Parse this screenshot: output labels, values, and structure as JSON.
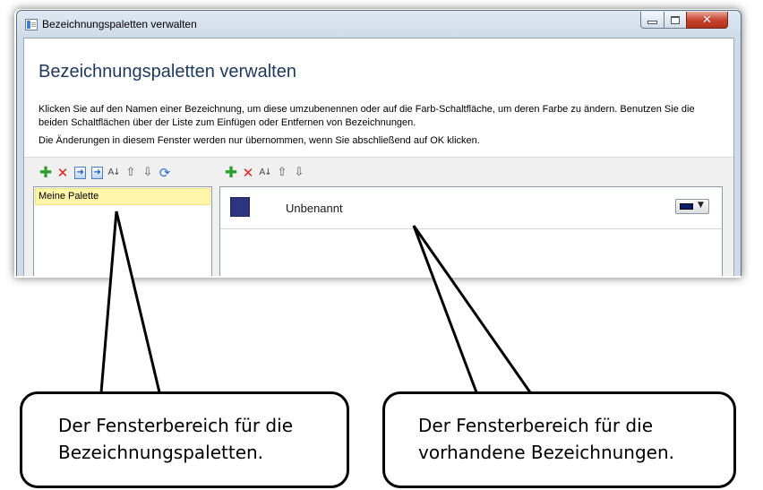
{
  "window": {
    "title": "Bezeichnungspaletten verwalten",
    "close_symbol": "✕"
  },
  "header": {
    "heading": "Bezeichnungspaletten verwalten",
    "description": "Klicken Sie auf den Namen einer Bezeichnung, um diese umzubenennen oder auf die Farb-Schaltfläche, um deren Farbe zu ändern. Benutzen Sie die beiden Schaltflächen über der Liste zum Einfügen oder Entfernen von Bezeichnungen.",
    "note": "Die Änderungen in diesem Fenster werden nur übernommen, wenn Sie abschließend auf OK klicken."
  },
  "palette_toolbar": {
    "icons": [
      "add-icon",
      "delete-icon",
      "export-icon",
      "import-icon",
      "sort-icon",
      "move-up-icon",
      "move-down-icon",
      "refresh-icon"
    ]
  },
  "label_toolbar": {
    "icons": [
      "add-icon",
      "delete-icon",
      "sort-icon",
      "move-up-icon",
      "move-down-icon"
    ]
  },
  "palettes": {
    "items": [
      {
        "name": "Meine Palette",
        "selected": true
      }
    ]
  },
  "labels": {
    "items": [
      {
        "name": "Unbenannt",
        "color": "#2c3680",
        "button_color": "#0a1a6e"
      }
    ]
  },
  "annotations": {
    "left": {
      "line1": "Der Fensterbereich  für die",
      "line2": "Bezeichnungspaletten."
    },
    "right": {
      "line1": "Der Fensterbereich  für die",
      "line2": "vorhandene Bezeichnungen."
    }
  },
  "colors": {
    "selection_highlight": "#fff6a9",
    "heading_text": "#1e395b",
    "close_button": "#c8452f"
  }
}
